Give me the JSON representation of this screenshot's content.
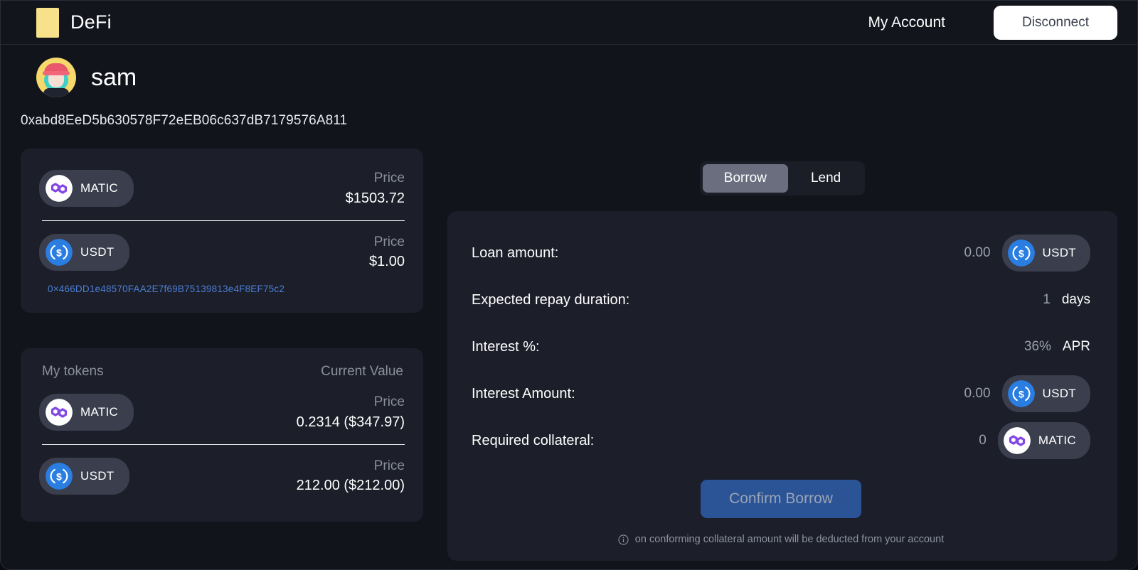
{
  "header": {
    "brand": "DeFi",
    "logo_color": "#f7e18a",
    "my_account": "My Account",
    "disconnect": "Disconnect"
  },
  "user": {
    "name": "sam",
    "address": "0xabd8EeD5b630578F72eEB06c637dB7179576A811"
  },
  "tabs": {
    "items": [
      {
        "label": "Borrow",
        "active": true
      },
      {
        "label": "Lend",
        "active": false
      }
    ]
  },
  "price_card": {
    "rows": [
      {
        "symbol": "MATIC",
        "icon": "matic-icon",
        "value_label": "Price",
        "value_amount": "$1503.72"
      },
      {
        "symbol": "USDT",
        "icon": "usdt-icon",
        "value_label": "Price",
        "value_amount": "$1.00"
      }
    ],
    "contract_link": "0×466DD1e48570FAA2E7f69B75139813e4F8EF75c2"
  },
  "my_tokens": {
    "header_left": "My tokens",
    "header_right": "Current Value",
    "rows": [
      {
        "symbol": "MATIC",
        "icon": "matic-icon",
        "value_label": "Price",
        "value_amount": "0.2314 ($347.97)"
      },
      {
        "symbol": "USDT",
        "icon": "usdt-icon",
        "value_label": "Price",
        "value_amount": "212.00 ($212.00)"
      }
    ]
  },
  "borrow_form": {
    "rows": [
      {
        "label": "Loan amount:",
        "value": "0.00",
        "token": "USDT",
        "token_icon": "usdt-icon",
        "unit": ""
      },
      {
        "label": "Expected repay duration:",
        "value": "1",
        "token": "",
        "token_icon": "",
        "unit": "days"
      },
      {
        "label": "Interest %:",
        "value": "36%",
        "token": "",
        "token_icon": "",
        "unit": "APR"
      },
      {
        "label": "Interest Amount:",
        "value": "0.00",
        "token": "USDT",
        "token_icon": "usdt-icon",
        "unit": ""
      },
      {
        "label": "Required collateral:",
        "value": "0",
        "token": "MATIC",
        "token_icon": "matic-icon",
        "unit": ""
      }
    ],
    "confirm_label": "Confirm Borrow",
    "confirm_color": "#2b5496",
    "note": "on conforming collateral amount will be deducted from your account"
  },
  "colors": {
    "page_bg": "#12141c",
    "card_bg": "#1c1e29",
    "pill_bg": "#3a3e4d",
    "accent_blue": "#2b5496",
    "link_blue": "#4b7fd6",
    "matic_purple": "#8247e5",
    "usdt_blue": "#2a7de1"
  }
}
